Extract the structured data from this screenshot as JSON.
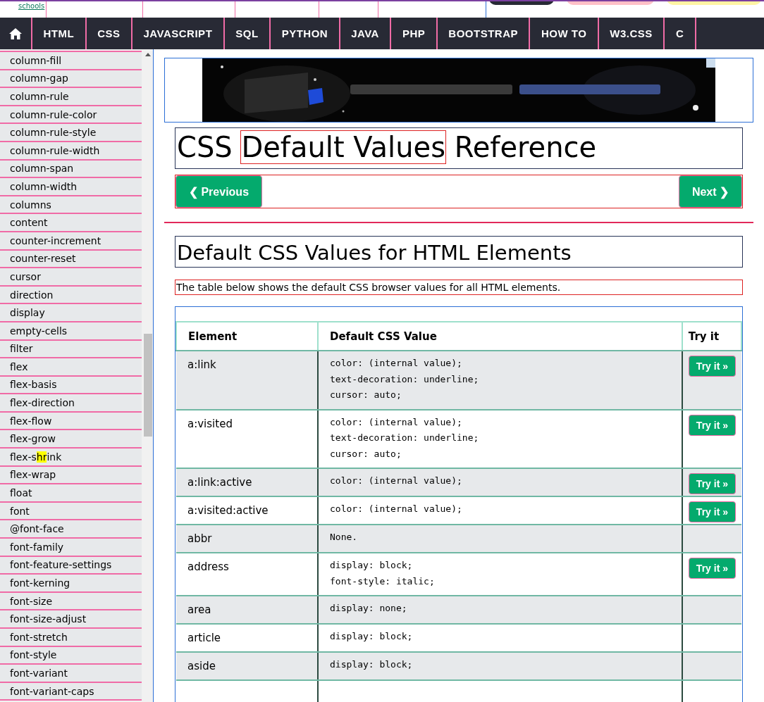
{
  "top_strip": {
    "logo_text": "schools",
    "buttons": [
      {
        "kind": "dark"
      },
      {
        "kind": "pink"
      },
      {
        "kind": "yellow"
      }
    ]
  },
  "topnav": {
    "items": [
      {
        "kind": "home"
      },
      {
        "kind": "text",
        "label": "HTML"
      },
      {
        "kind": "text",
        "label": "CSS"
      },
      {
        "kind": "text",
        "label": "JAVASCRIPT"
      },
      {
        "kind": "text",
        "label": "SQL"
      },
      {
        "kind": "text",
        "label": "PYTHON"
      },
      {
        "kind": "text",
        "label": "JAVA"
      },
      {
        "kind": "text",
        "label": "PHP"
      },
      {
        "kind": "text",
        "label": "BOOTSTRAP"
      },
      {
        "kind": "text",
        "label": "HOW TO"
      },
      {
        "kind": "text",
        "label": "W3.CSS"
      },
      {
        "kind": "text",
        "label": "C"
      }
    ]
  },
  "sidebar": {
    "items": [
      {
        "label": "column-fill"
      },
      {
        "label": "column-gap"
      },
      {
        "label": "column-rule"
      },
      {
        "label": "column-rule-color"
      },
      {
        "label": "column-rule-style"
      },
      {
        "label": "column-rule-width"
      },
      {
        "label": "column-span"
      },
      {
        "label": "column-width"
      },
      {
        "label": "columns"
      },
      {
        "label": "content"
      },
      {
        "label": "counter-increment"
      },
      {
        "label": "counter-reset"
      },
      {
        "label": "cursor"
      },
      {
        "label": "direction"
      },
      {
        "label": "display"
      },
      {
        "label": "empty-cells"
      },
      {
        "label": "filter"
      },
      {
        "label": "flex"
      },
      {
        "label": "flex-basis"
      },
      {
        "label": "flex-direction"
      },
      {
        "label": "flex-flow"
      },
      {
        "label": "flex-grow"
      },
      {
        "find_match": {
          "before": "flex-s",
          "match": "hr",
          "after": "ink"
        }
      },
      {
        "label": "flex-wrap"
      },
      {
        "label": "float"
      },
      {
        "label": "font"
      },
      {
        "label": "@font-face"
      },
      {
        "label": "font-family"
      },
      {
        "label": "font-feature-settings"
      },
      {
        "label": "font-kerning"
      },
      {
        "label": "font-size"
      },
      {
        "label": "font-size-adjust"
      },
      {
        "label": "font-stretch"
      },
      {
        "label": "font-style"
      },
      {
        "label": "font-variant"
      },
      {
        "label": "font-variant-caps"
      }
    ]
  },
  "title": {
    "before": "CSS",
    "highlighted": "Default Values",
    "after": "Reference"
  },
  "pager": {
    "previous": "❮ Previous",
    "next": "Next ❯"
  },
  "heading": "Default CSS Values for HTML Elements",
  "intro": "The table below shows the default CSS browser values for all HTML elements.",
  "table": {
    "columns": [
      "Element",
      "Default CSS Value",
      "Try it"
    ],
    "rows": [
      {
        "element": "a:link",
        "value": [
          "color: (internal value);",
          "text-decoration: underline;",
          "cursor: auto;"
        ],
        "try": "Try it »"
      },
      {
        "element": "a:visited",
        "value": [
          "color: (internal value);",
          "text-decoration: underline;",
          "cursor: auto;"
        ],
        "try": "Try it »"
      },
      {
        "element": "a:link:active",
        "value": [
          "color: (internal value);"
        ],
        "try": "Try it »"
      },
      {
        "element": "a:visited:active",
        "value": [
          "color: (internal value);"
        ],
        "try": "Try it »"
      },
      {
        "element": "abbr",
        "value": [
          "None."
        ]
      },
      {
        "element": "address",
        "value": [
          "display: block;",
          "font-style: italic;"
        ],
        "try": "Try it »"
      },
      {
        "element": "area",
        "value": [
          "display: none;"
        ]
      },
      {
        "element": "article",
        "value": [
          "display: block;"
        ]
      },
      {
        "element": "aside",
        "value": [
          "display: block;"
        ]
      }
    ]
  }
}
